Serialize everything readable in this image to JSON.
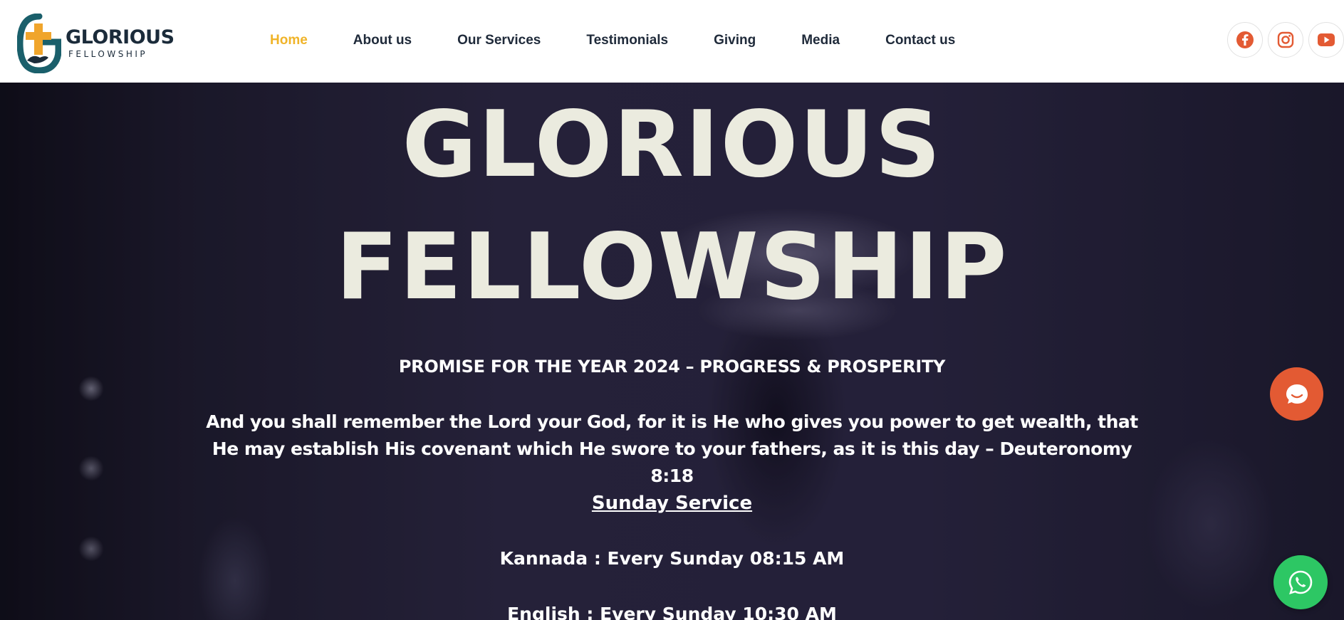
{
  "brand": {
    "title": "GLORIOUS",
    "subtitle": "FELLOWSHIP"
  },
  "nav": {
    "items": [
      "Home",
      "About us",
      "Our Services",
      "Testimonials",
      "Giving",
      "Media",
      "Contact us"
    ],
    "active": "Home"
  },
  "social": {
    "icons": [
      "facebook-icon",
      "instagram-icon",
      "youtube-icon"
    ],
    "color": "#e35a33"
  },
  "hero": {
    "title_line1": "GLORIOUS",
    "title_line2": "FELLOWSHIP",
    "promise": "PROMISE FOR THE YEAR 2024 – PROGRESS & PROSPERITY",
    "verse": "And you shall remember the Lord your God, for it is He who gives you power to get wealth, that He may establish His covenant which He swore to your fathers, as it is this day – Deuteronomy 8:18",
    "service_heading": "Sunday Service",
    "kannada": "Kannada : Every Sunday 08:15 AM",
    "english": "English : Every Sunday 10:30 AM"
  },
  "floating": {
    "chat_icon": "chat-bubble-icon",
    "whatsapp_icon": "whatsapp-icon"
  },
  "colors": {
    "accent": "#f0b429",
    "chat": "#e35a33",
    "whatsapp": "#2dc764"
  }
}
